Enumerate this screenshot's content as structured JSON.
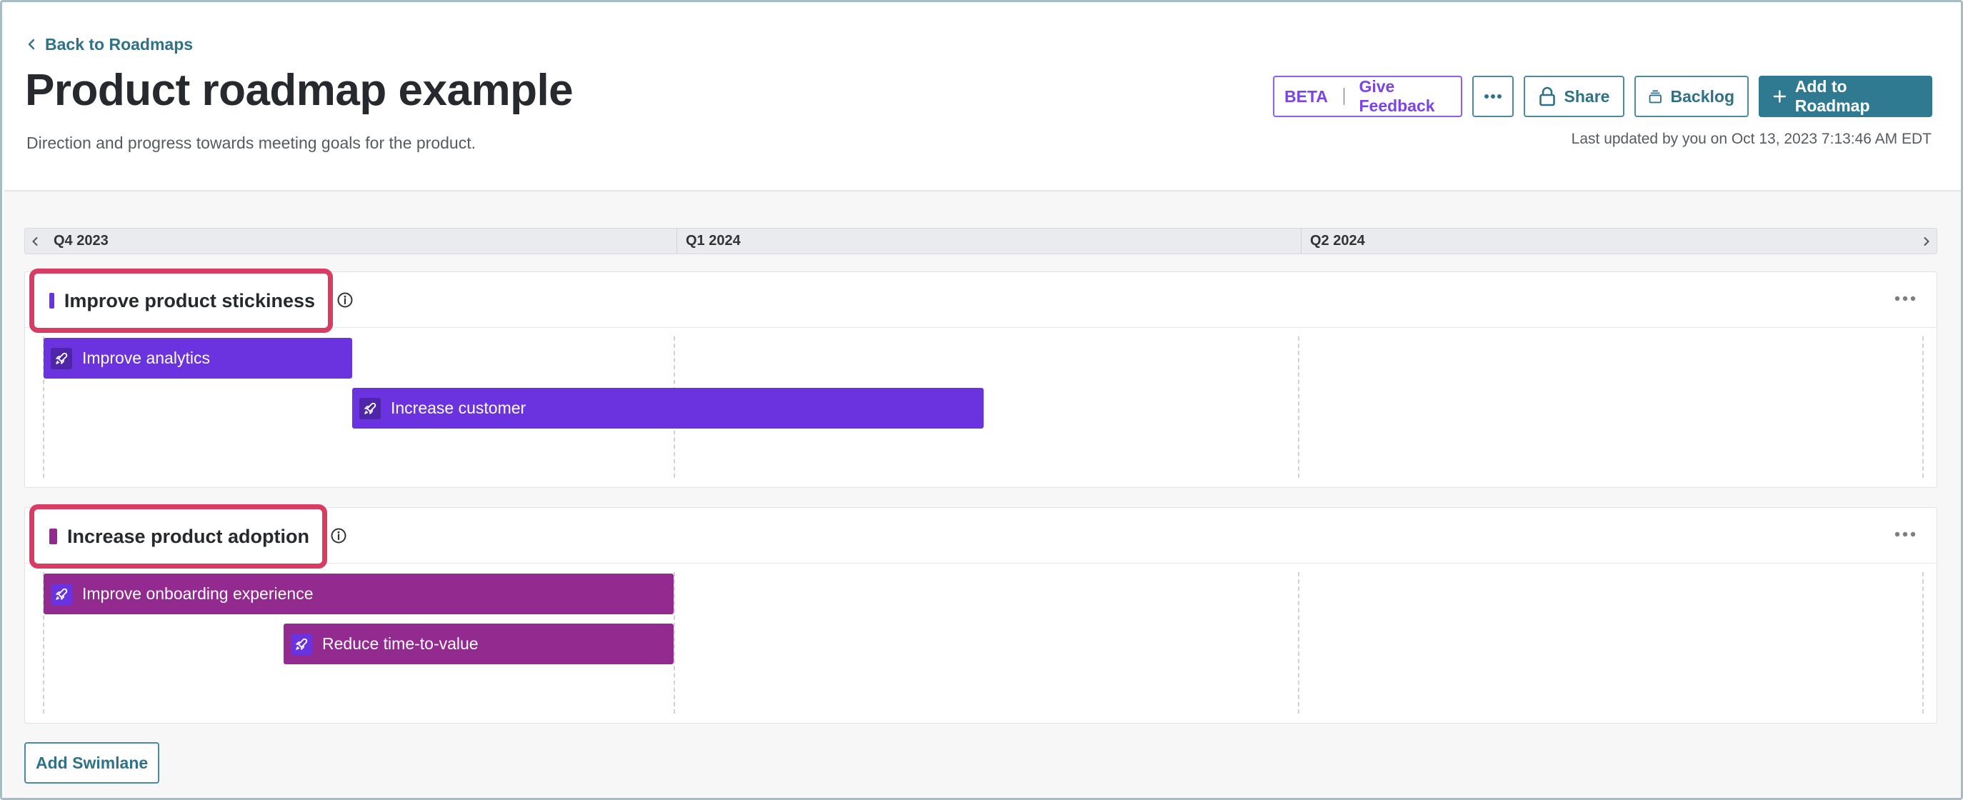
{
  "nav": {
    "back_label": "Back to Roadmaps"
  },
  "header": {
    "title": "Product roadmap example",
    "subtitle": "Direction and progress towards meeting goals for the product.",
    "last_updated": "Last updated by you on Oct 13, 2023 7:13:46 AM EDT"
  },
  "toolbar": {
    "beta_label": "BETA",
    "feedback_label": "Give Feedback",
    "share_label": "Share",
    "backlog_label": "Backlog",
    "add_label": "Add to Roadmap"
  },
  "timeline": {
    "quarters": [
      "Q4 2023",
      "Q1 2024",
      "Q2 2024"
    ]
  },
  "swimlanes": [
    {
      "title": "Improve product stickiness",
      "color": "#6b33e0",
      "items": [
        {
          "label": "Improve analytics",
          "icon": "rocket-icon",
          "color": "#6b33e0"
        },
        {
          "label": "Increase customer",
          "icon": "rocket-icon",
          "color": "#6b33e0"
        }
      ]
    },
    {
      "title": "Increase product adoption",
      "color": "#932a8f",
      "items": [
        {
          "label": "Improve onboarding experience",
          "icon": "rocket-icon",
          "color": "#932a8f"
        },
        {
          "label": "Reduce time-to-value",
          "icon": "rocket-icon",
          "color": "#932a8f"
        }
      ]
    }
  ],
  "actions": {
    "add_swimlane_label": "Add Swimlane"
  },
  "colors": {
    "accent": "#2f7a90",
    "beta": "#7a44e6",
    "highlight": "#d93c63"
  }
}
